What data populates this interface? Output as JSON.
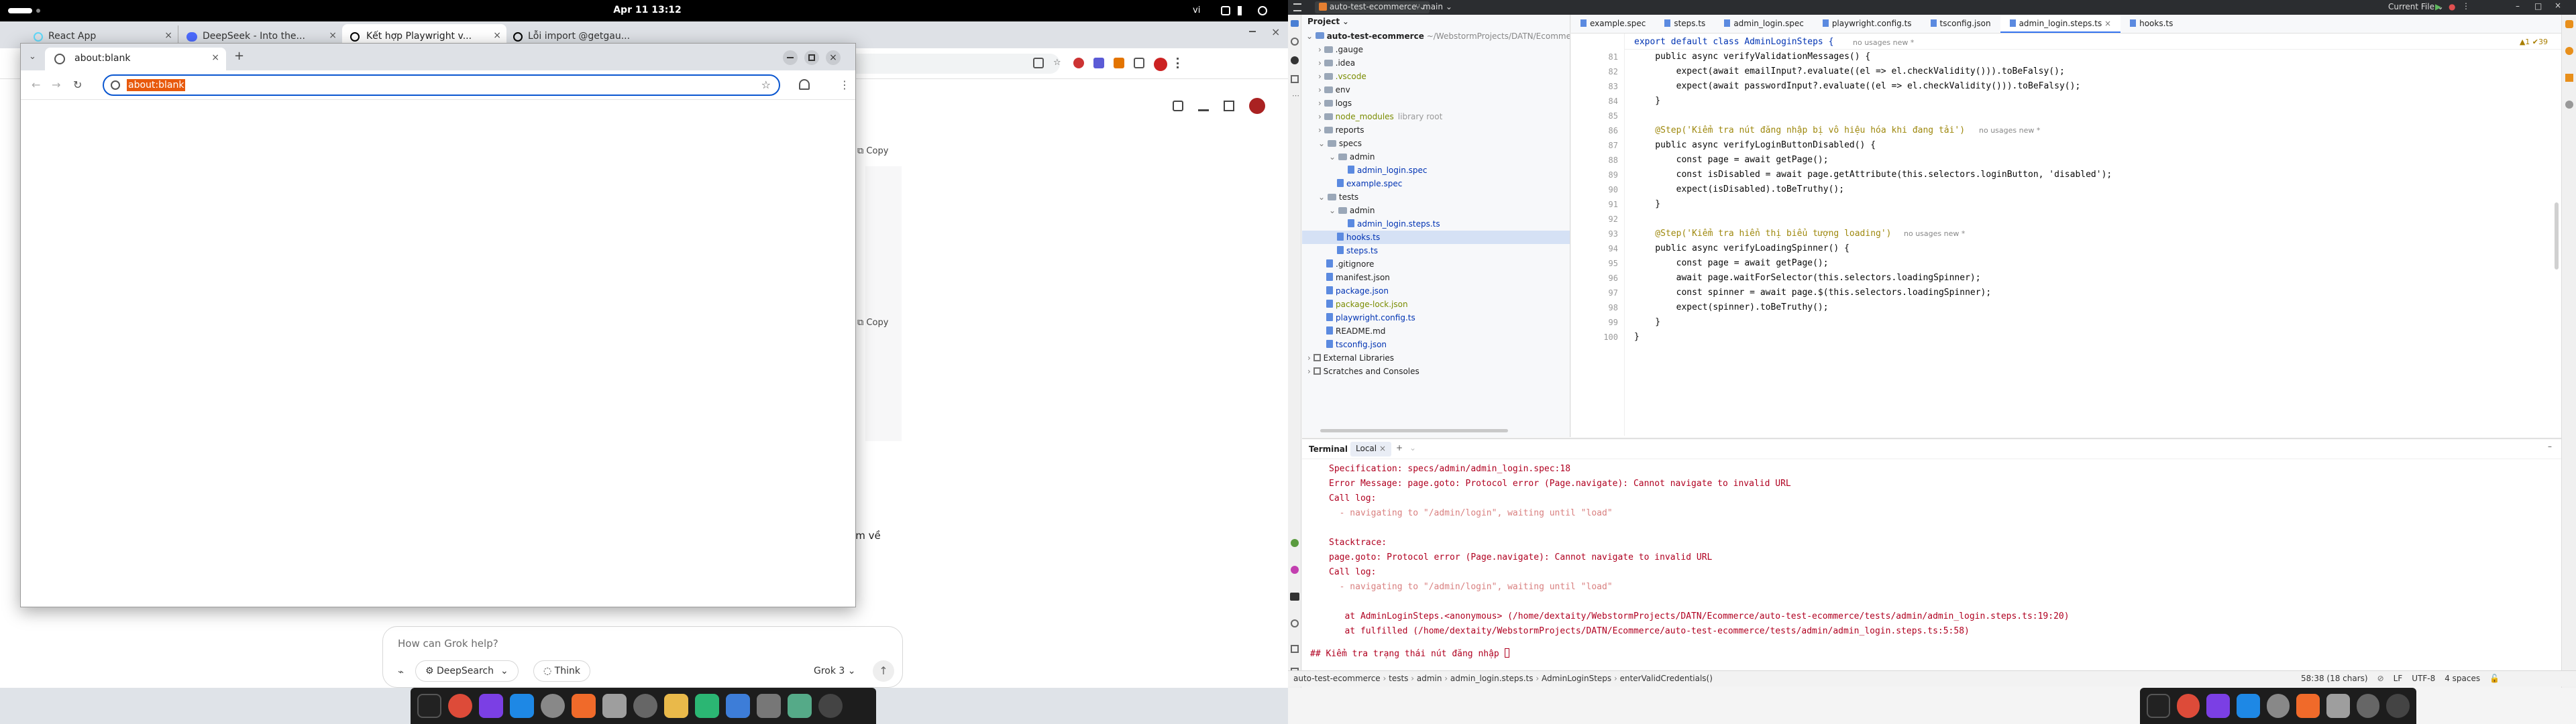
{
  "left": {
    "topbar": {
      "clock": "Apr 11  13:12",
      "lang": "vi"
    },
    "chrome": {
      "tabs": [
        {
          "label": "React App"
        },
        {
          "label": "DeepSeek - Into the..."
        },
        {
          "label": "Kết hợp Playwright v..."
        },
        {
          "label": "Lỗi import @getgau..."
        }
      ],
      "grok": {
        "placeholder": "How can Grok help?",
        "deepsearch": "DeepSearch",
        "think": "Think",
        "model": "Grok 3",
        "copy1": "Copy",
        "copy2": "Copy",
        "partial": "em về"
      }
    },
    "popup": {
      "tab_title": "about:blank",
      "url": "about:blank"
    }
  },
  "right": {
    "topbar": {
      "project": "auto-test-ecommerce",
      "branch": "main",
      "run_config": "Current File"
    },
    "project_panel": {
      "title": "Project",
      "root": "auto-test-ecommerce",
      "root_path": "~/WebstormProjects/DATN/Ecommerce/aut",
      "nodes": [
        {
          "label": ".gauge",
          "depth": 1,
          "kind": "folder",
          "color": "#222"
        },
        {
          "label": ".idea",
          "depth": 1,
          "kind": "folder",
          "color": "#222"
        },
        {
          "label": ".vscode",
          "depth": 1,
          "kind": "folder",
          "color": "#7a8c00"
        },
        {
          "label": "env",
          "depth": 1,
          "kind": "folder",
          "color": "#222"
        },
        {
          "label": "logs",
          "depth": 1,
          "kind": "folder",
          "color": "#222"
        },
        {
          "label": "node_modules",
          "extra": "library root",
          "depth": 1,
          "kind": "folder",
          "color": "#7a8c00"
        },
        {
          "label": "reports",
          "depth": 1,
          "kind": "folder",
          "color": "#222"
        },
        {
          "label": "specs",
          "depth": 1,
          "kind": "folder",
          "color": "#222",
          "open": true
        },
        {
          "label": "admin",
          "depth": 2,
          "kind": "folder",
          "color": "#222",
          "open": true
        },
        {
          "label": "admin_login.spec",
          "depth": 3,
          "kind": "file",
          "color": "#0033b3"
        },
        {
          "label": "example.spec",
          "depth": 2,
          "kind": "file",
          "color": "#0033b3"
        },
        {
          "label": "tests",
          "depth": 1,
          "kind": "folder",
          "color": "#222",
          "open": true
        },
        {
          "label": "admin",
          "depth": 2,
          "kind": "folder",
          "color": "#222",
          "open": true
        },
        {
          "label": "admin_login.steps.ts",
          "depth": 3,
          "kind": "file",
          "color": "#0033b3"
        },
        {
          "label": "hooks.ts",
          "depth": 2,
          "kind": "file",
          "color": "#0033b3",
          "selected": true
        },
        {
          "label": "steps.ts",
          "depth": 2,
          "kind": "file",
          "color": "#0033b3"
        },
        {
          "label": ".gitignore",
          "depth": 1,
          "kind": "file",
          "color": "#222"
        },
        {
          "label": "manifest.json",
          "depth": 1,
          "kind": "file",
          "color": "#222"
        },
        {
          "label": "package.json",
          "depth": 1,
          "kind": "file",
          "color": "#0033b3"
        },
        {
          "label": "package-lock.json",
          "depth": 1,
          "kind": "file",
          "color": "#7a8c00"
        },
        {
          "label": "playwright.config.ts",
          "depth": 1,
          "kind": "file",
          "color": "#0033b3"
        },
        {
          "label": "README.md",
          "depth": 1,
          "kind": "file",
          "color": "#222"
        },
        {
          "label": "tsconfig.json",
          "depth": 1,
          "kind": "file",
          "color": "#0033b3"
        },
        {
          "label": "External Libraries",
          "depth": 0,
          "kind": "lib",
          "color": "#222"
        },
        {
          "label": "Scratches and Consoles",
          "depth": 0,
          "kind": "lib",
          "color": "#222"
        }
      ]
    },
    "editor": {
      "tabs": [
        {
          "label": "example.spec"
        },
        {
          "label": "steps.ts"
        },
        {
          "label": "admin_login.spec"
        },
        {
          "label": "playwright.config.ts"
        },
        {
          "label": "tsconfig.json"
        },
        {
          "label": "admin_login.steps.ts",
          "active": true
        },
        {
          "label": "hooks.ts"
        }
      ],
      "header_line": "export default class AdminLoginSteps {",
      "header_hint": "no usages  new *",
      "counters": "▲1 ✔39",
      "lines": [
        {
          "n": "81",
          "code": "    public async verifyValidationMessages() {"
        },
        {
          "n": "82",
          "code": "        expect(await emailInput?.evaluate((el => el.checkValidity())).toBeFalsy();"
        },
        {
          "n": "83",
          "code": "        expect(await passwordInput?.evaluate((el => el.checkValidity())).toBeFalsy();"
        },
        {
          "n": "84",
          "code": "    }"
        },
        {
          "n": "85",
          "code": ""
        },
        {
          "n": "86",
          "code": "    @Step('Kiểm tra nút đăng nhập bị vô hiệu hóa khi đang tải')",
          "hint": "no usages  new *"
        },
        {
          "n": "87",
          "code": "    public async verifyLoginButtonDisabled() {"
        },
        {
          "n": "88",
          "code": "        const page = await getPage();"
        },
        {
          "n": "89",
          "code": "        const isDisabled = await page.getAttribute(this.selectors.loginButton, 'disabled');"
        },
        {
          "n": "90",
          "code": "        expect(isDisabled).toBeTruthy();"
        },
        {
          "n": "91",
          "code": "    }"
        },
        {
          "n": "92",
          "code": ""
        },
        {
          "n": "93",
          "code": "    @Step('Kiểm tra hiển thị biểu tượng loading')",
          "hint": "no usages  new *"
        },
        {
          "n": "94",
          "code": "    public async verifyLoadingSpinner() {"
        },
        {
          "n": "95",
          "code": "        const page = await getPage();"
        },
        {
          "n": "96",
          "code": "        await page.waitForSelector(this.selectors.loadingSpinner);"
        },
        {
          "n": "97",
          "code": "        const spinner = await page.$(this.selectors.loadingSpinner);"
        },
        {
          "n": "98",
          "code": "        expect(spinner).toBeTruthy();"
        },
        {
          "n": "99",
          "code": "    }"
        },
        {
          "n": "100",
          "code": "}"
        }
      ]
    },
    "terminal": {
      "title": "Terminal",
      "tab": "Local",
      "lines": [
        {
          "text": "Specification: specs/admin/admin_login.spec:18",
          "color": "#b00020"
        },
        {
          "text": "Error Message: page.goto: Protocol error (Page.navigate): Cannot navigate to invalid URL",
          "color": "#b00020"
        },
        {
          "text": "Call log:",
          "color": "#b00020"
        },
        {
          "text": "  - navigating to \"/admin/login\", waiting until \"load\"",
          "color": "#d98080"
        },
        {
          "text": "",
          "color": "#000"
        },
        {
          "text": "Stacktrace:",
          "color": "#b00020"
        },
        {
          "text": "page.goto: Protocol error (Page.navigate): Cannot navigate to invalid URL",
          "color": "#b00020"
        },
        {
          "text": "Call log:",
          "color": "#b00020"
        },
        {
          "text": "  - navigating to \"/admin/login\", waiting until \"load\"",
          "color": "#d98080"
        },
        {
          "text": "",
          "color": "#000"
        },
        {
          "text": "   at AdminLoginSteps.<anonymous> (/home/dextaity/WebstormProjects/DATN/Ecommerce/auto-test-ecommerce/tests/admin/admin_login.steps.ts:19:20)",
          "color": "#b00020"
        },
        {
          "text": "   at fulfilled (/home/dextaity/WebstormProjects/DATN/Ecommerce/auto-test-ecommerce/tests/admin/admin_login.steps.ts:5:58)",
          "color": "#b00020"
        }
      ],
      "prompt": "## Kiểm tra trạng thái nút đăng nhập"
    },
    "statusbar": {
      "crumbs": [
        "auto-test-ecommerce",
        "tests",
        "admin",
        "admin_login.steps.ts",
        "AdminLoginSteps",
        "enterValidCredentials()"
      ],
      "position": "58:38 (18 chars)",
      "line_sep": "LF",
      "encoding": "UTF-8",
      "indent": "4 spaces"
    }
  }
}
